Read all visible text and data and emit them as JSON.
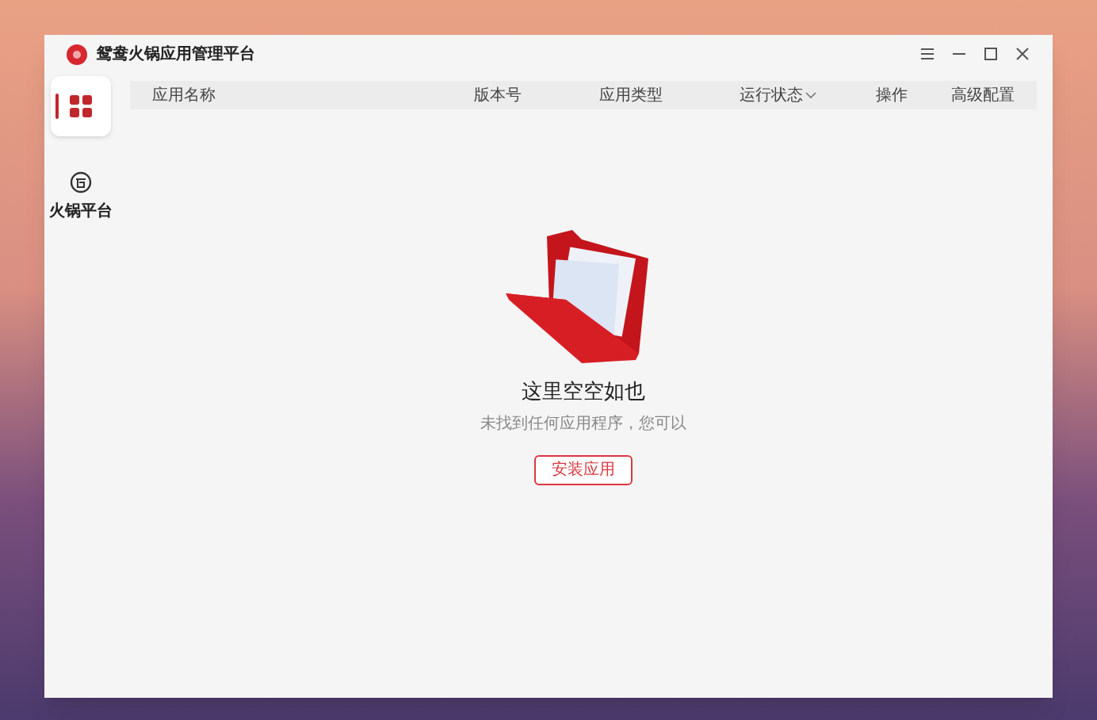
{
  "window": {
    "title": "鸳鸯火锅应用管理平台"
  },
  "sidebar": {
    "items": [
      {
        "kind": "apps",
        "selected": true
      },
      {
        "kind": "platform",
        "label": "火锅平台",
        "selected": false
      }
    ]
  },
  "table": {
    "columns": [
      {
        "label": "应用名称",
        "sortable": false
      },
      {
        "label": "版本号",
        "sortable": false
      },
      {
        "label": "应用类型",
        "sortable": false
      },
      {
        "label": "运行状态",
        "sortable": true
      },
      {
        "label": "操作",
        "sortable": false
      },
      {
        "label": "高级配置",
        "sortable": false
      }
    ]
  },
  "empty_state": {
    "title": "这里空空如也",
    "message": "未找到任何应用程序，您可以",
    "button": "安装应用"
  }
}
